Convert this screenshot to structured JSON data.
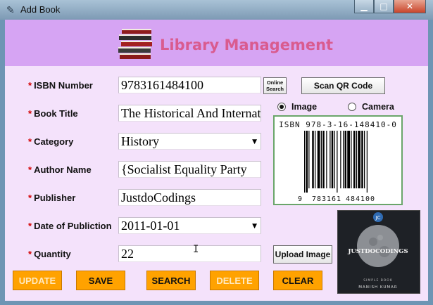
{
  "window": {
    "title": "Add Book",
    "min_glyph": "▁",
    "max_glyph": "□",
    "close_glyph": "✕"
  },
  "header": {
    "title": "Library Management"
  },
  "form": {
    "isbn": {
      "label": "ISBN Number",
      "value": "9783161484100"
    },
    "title": {
      "label": "Book Title",
      "value": "The Historical And International"
    },
    "category": {
      "label": "Category",
      "value": "History"
    },
    "author": {
      "label": "Author Name",
      "value": "{Socialist Equality Party"
    },
    "publisher": {
      "label": "Publisher",
      "value": "JustdoCodings"
    },
    "date": {
      "label": "Date of Publiction",
      "value": "2011-01-01"
    },
    "quantity": {
      "label": "Quantity",
      "value": "22"
    },
    "required_marker": "*"
  },
  "online_search": {
    "line1": "Online",
    "line2": "Search"
  },
  "scan_qr": {
    "label": "Scan QR Code"
  },
  "source": {
    "image_label": "Image",
    "camera_label": "Camera",
    "selected": "Image"
  },
  "barcode": {
    "top_text": "ISBN 978-3-16-148410-0",
    "bottom_first": "9",
    "bottom_left": "783161",
    "bottom_right": "484100"
  },
  "upload_image": {
    "label": "Upload Image"
  },
  "cover": {
    "badge": "JC",
    "title": "JUSTDOCODINGS",
    "subtitle": "SIMPLE BOOK",
    "author": "MANISH KUMAR"
  },
  "actions": {
    "update": {
      "label": "UPDATE",
      "enabled": false
    },
    "save": {
      "label": "SAVE",
      "enabled": true
    },
    "search": {
      "label": "SEARCH",
      "enabled": true
    },
    "delete": {
      "label": "DELETE",
      "enabled": false
    },
    "clear": {
      "label": "CLEAR",
      "enabled": true
    }
  },
  "icons": {
    "app": "feather-icon",
    "books": "book-stack-icon",
    "dropdown": "chevron-down-icon",
    "cursor": "text-cursor-icon"
  },
  "colors": {
    "header_bg": "#d6a4f3",
    "title_color": "#d95b8f",
    "client_bg": "#f4e2fb",
    "button_orange": "#ffa200",
    "required_red": "#d20000"
  }
}
